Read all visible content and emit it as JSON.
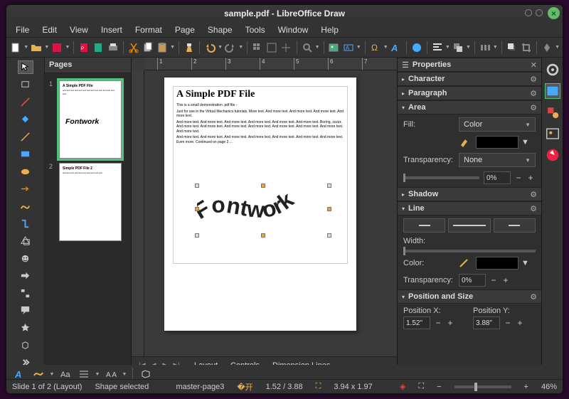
{
  "window": {
    "title": "sample.pdf - LibreOffice Draw"
  },
  "menu": [
    "File",
    "Edit",
    "View",
    "Insert",
    "Format",
    "Page",
    "Shape",
    "Tools",
    "Window",
    "Help"
  ],
  "pages_panel": {
    "title": "Pages"
  },
  "doc": {
    "title": "A Simple PDF File",
    "p1": "This is a small demonstration .pdf file -",
    "p2": "Just for use in the Virtual Mechanics tutorials. More text. And more text. And more text. And more text. And more text.",
    "p3": "And more text. And more text. And more text. And more text. And more text. And more text. Boring, zzzzz. And more text. And more text. And more text. And more text. And more text. And more text. And more text. And more text.",
    "p4": "And more text. And more text. And more text. And more text. And more text. And more text. And more text. Even more. Continued on page 2 ...",
    "fontwork": "Fontwork",
    "thumb2_title": "Simple PDF File 2"
  },
  "bottom_tabs": {
    "layout": "Layout",
    "controls": "Controls",
    "dimension": "Dimension Lines"
  },
  "properties": {
    "title": "Properties",
    "sections": {
      "character": "Character",
      "paragraph": "Paragraph",
      "area": "Area",
      "shadow": "Shadow",
      "line": "Line",
      "possize": "Position and Size"
    },
    "area": {
      "fill_label": "Fill:",
      "fill_value": "Color",
      "transparency_label": "Transparency:",
      "transparency_value": "None",
      "pct": "0%"
    },
    "line": {
      "width_label": "Width:",
      "color_label": "Color:",
      "transparency_label": "Transparency:",
      "transparency_value": "0%"
    },
    "pos": {
      "x_label": "Position X:",
      "y_label": "Position Y:",
      "x_value": "1.52\"",
      "y_value": "3.88\""
    }
  },
  "status": {
    "slide": "Slide 1 of 2 (Layout)",
    "sel": "Shape selected",
    "master": "master-page3",
    "coords": "1.52 / 3.88",
    "size": "3.94 x 1.97",
    "zoom": "46%"
  },
  "ruler_ticks": [
    "1",
    "2",
    "3",
    "4",
    "5",
    "6",
    "7"
  ]
}
